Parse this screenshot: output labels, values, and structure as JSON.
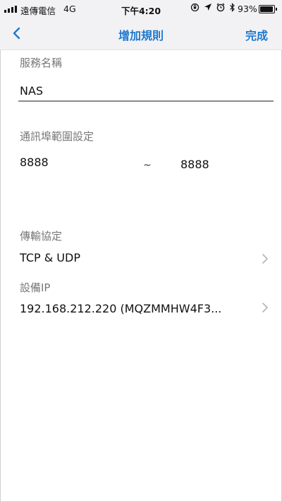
{
  "status_bar": {
    "carrier": "遠傳電信",
    "network": "4G",
    "time": "下午4:20",
    "battery_percent": "93%",
    "battery_level": 0.93,
    "icons": [
      "screen-rotation-lock-icon",
      "location-arrow-icon",
      "alarm-icon",
      "bluetooth-icon"
    ]
  },
  "nav": {
    "title": "增加規則",
    "done_label": "完成",
    "back_icon": "chevron-left-icon",
    "accent_color": "#1f78ce"
  },
  "form": {
    "service_name": {
      "label": "服務名稱",
      "value": "NAS"
    },
    "port_range": {
      "label": "通訊埠範圍設定",
      "start": "8888",
      "separator": "~",
      "end": "8888"
    },
    "protocol": {
      "label": "傳輸協定",
      "value": "TCP & UDP"
    },
    "device_ip": {
      "label": "設備IP",
      "value": "192.168.212.220 (MQZMMHW4F3..."
    }
  }
}
